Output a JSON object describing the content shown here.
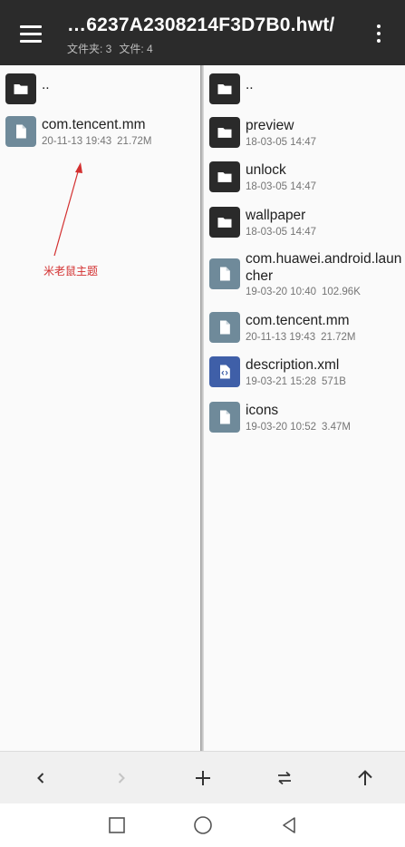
{
  "header": {
    "title": "…6237A2308214F3D7B0.hwt/",
    "subtitle_folders": "文件夹: 3",
    "subtitle_files": "文件: 4",
    "menu_icon": "hamburger-menu-icon",
    "more_icon": "more-vert-icon"
  },
  "left_pane": {
    "items": [
      {
        "name": "..",
        "type": "parent",
        "icon": "folder-icon"
      },
      {
        "name": "com.tencent.mm",
        "date": "20-11-13 19:43",
        "size": "21.72M",
        "type": "file",
        "icon": "file-icon"
      }
    ],
    "annotation": "米老鼠主题",
    "annotation_color": "#d32f2f"
  },
  "right_pane": {
    "items": [
      {
        "name": "..",
        "type": "parent",
        "icon": "folder-icon"
      },
      {
        "name": "preview",
        "date": "18-03-05 14:47",
        "type": "folder",
        "icon": "folder-icon"
      },
      {
        "name": "unlock",
        "date": "18-03-05 14:47",
        "type": "folder",
        "icon": "folder-icon"
      },
      {
        "name": "wallpaper",
        "date": "18-03-05 14:47",
        "type": "folder",
        "icon": "folder-icon"
      },
      {
        "name": "com.huawei.android.launcher",
        "date": "19-03-20 10:40",
        "size": "102.96K",
        "type": "file",
        "icon": "file-icon"
      },
      {
        "name": "com.tencent.mm",
        "date": "20-11-13 19:43",
        "size": "21.72M",
        "type": "file",
        "icon": "file-icon"
      },
      {
        "name": "description.xml",
        "date": "19-03-21 15:28",
        "size": "571B",
        "type": "xml",
        "icon": "xml-file-icon"
      },
      {
        "name": "icons",
        "date": "19-03-20 10:52",
        "size": "3.47M",
        "type": "file",
        "icon": "file-icon"
      }
    ]
  },
  "toolbar": {
    "buttons": [
      "back-icon",
      "forward-icon",
      "add-icon",
      "swap-panes-icon",
      "up-icon"
    ]
  },
  "navbar": {
    "buttons": [
      "recents-square-icon",
      "home-circle-icon",
      "back-triangle-icon"
    ]
  },
  "colors": {
    "appbar": "#2b2b2b",
    "folder_icon_bg": "#2a2a2a",
    "file_icon_bg": "#6f8a9a",
    "xml_icon_bg": "#3f5fa8"
  }
}
